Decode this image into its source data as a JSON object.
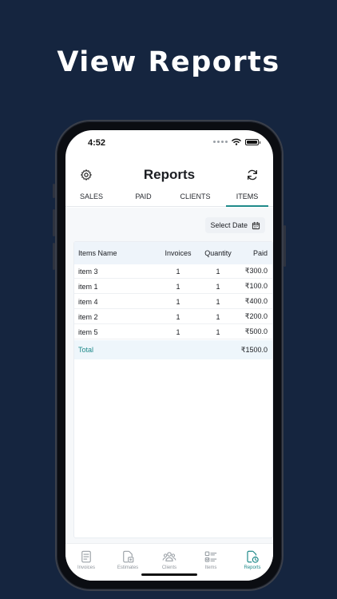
{
  "headline": "View Reports",
  "status": {
    "time": "4:52"
  },
  "header": {
    "title": "Reports",
    "settings_icon": "gear-icon",
    "refresh_icon": "refresh-icon"
  },
  "tabs": [
    {
      "label": "SALES",
      "active": false
    },
    {
      "label": "PAID",
      "active": false
    },
    {
      "label": "CLIENTS",
      "active": false
    },
    {
      "label": "ITEMS",
      "active": true
    }
  ],
  "filter": {
    "select_date_label": "Select Date",
    "icon": "calendar-icon"
  },
  "table": {
    "columns": [
      "Items Name",
      "Invoices",
      "Quantity",
      "Paid"
    ],
    "rows": [
      {
        "name": "item 3",
        "invoices": "1",
        "quantity": "1",
        "paid": "₹300.0"
      },
      {
        "name": "item 1",
        "invoices": "1",
        "quantity": "1",
        "paid": "₹100.0"
      },
      {
        "name": "item 4",
        "invoices": "1",
        "quantity": "1",
        "paid": "₹400.0"
      },
      {
        "name": "item 2",
        "invoices": "1",
        "quantity": "1",
        "paid": "₹200.0"
      },
      {
        "name": "item 5",
        "invoices": "1",
        "quantity": "1",
        "paid": "₹500.0"
      }
    ],
    "total": {
      "label": "Total",
      "paid": "₹1500.0"
    }
  },
  "bottom_nav": [
    {
      "label": "Invoices",
      "icon": "invoice-icon",
      "active": false
    },
    {
      "label": "Estimates",
      "icon": "estimate-icon",
      "active": false
    },
    {
      "label": "Clients",
      "icon": "clients-icon",
      "active": false
    },
    {
      "label": "Items",
      "icon": "items-icon",
      "active": false
    },
    {
      "label": "Reports",
      "icon": "reports-icon",
      "active": true
    }
  ],
  "colors": {
    "background": "#15253f",
    "accent": "#1f8a8a",
    "header_row": "#eef4fa"
  }
}
